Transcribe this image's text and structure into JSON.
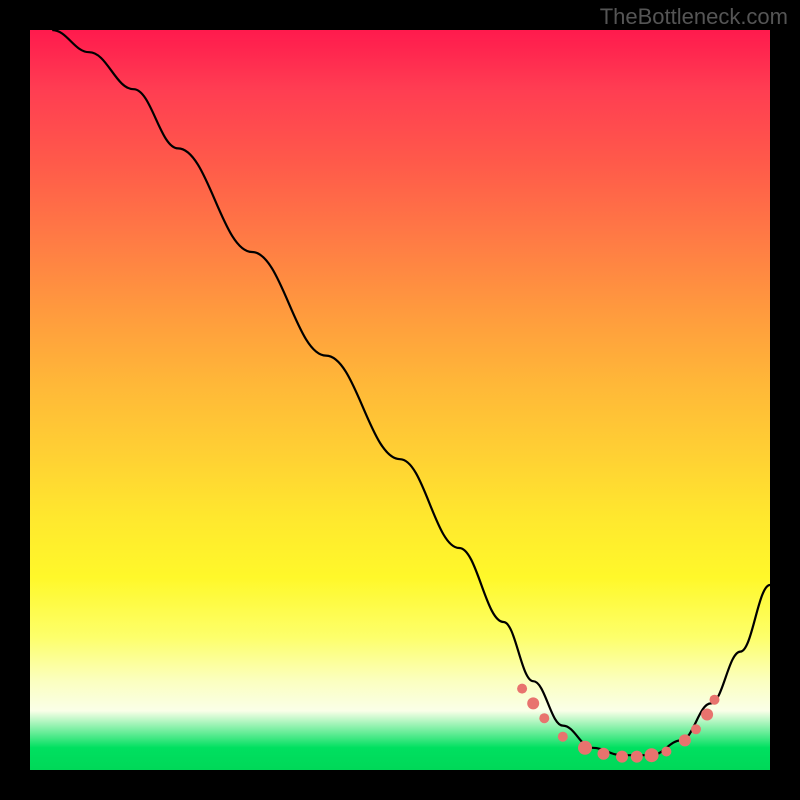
{
  "watermark": "TheBottleneck.com",
  "chart_data": {
    "type": "line",
    "title": "",
    "xlabel": "",
    "ylabel": "",
    "xlim": [
      0,
      1
    ],
    "ylim": [
      0,
      1
    ],
    "series": [
      {
        "name": "curve",
        "points": [
          [
            0.03,
            1.0
          ],
          [
            0.08,
            0.97
          ],
          [
            0.14,
            0.92
          ],
          [
            0.2,
            0.84
          ],
          [
            0.3,
            0.7
          ],
          [
            0.4,
            0.56
          ],
          [
            0.5,
            0.42
          ],
          [
            0.58,
            0.3
          ],
          [
            0.64,
            0.2
          ],
          [
            0.68,
            0.12
          ],
          [
            0.72,
            0.06
          ],
          [
            0.76,
            0.03
          ],
          [
            0.8,
            0.02
          ],
          [
            0.84,
            0.02
          ],
          [
            0.88,
            0.04
          ],
          [
            0.92,
            0.09
          ],
          [
            0.96,
            0.16
          ],
          [
            1.0,
            0.25
          ]
        ]
      }
    ],
    "markers": [
      {
        "x": 0.665,
        "y": 0.11,
        "r": 5
      },
      {
        "x": 0.68,
        "y": 0.09,
        "r": 6
      },
      {
        "x": 0.695,
        "y": 0.07,
        "r": 5
      },
      {
        "x": 0.72,
        "y": 0.045,
        "r": 5
      },
      {
        "x": 0.75,
        "y": 0.03,
        "r": 7
      },
      {
        "x": 0.775,
        "y": 0.022,
        "r": 6
      },
      {
        "x": 0.8,
        "y": 0.018,
        "r": 6
      },
      {
        "x": 0.82,
        "y": 0.018,
        "r": 6
      },
      {
        "x": 0.84,
        "y": 0.02,
        "r": 7
      },
      {
        "x": 0.86,
        "y": 0.025,
        "r": 5
      },
      {
        "x": 0.885,
        "y": 0.04,
        "r": 6
      },
      {
        "x": 0.9,
        "y": 0.055,
        "r": 5
      },
      {
        "x": 0.915,
        "y": 0.075,
        "r": 6
      },
      {
        "x": 0.925,
        "y": 0.095,
        "r": 5
      }
    ],
    "gradient_stops": [
      {
        "pos": 0.0,
        "color": "#ff1a4d"
      },
      {
        "pos": 0.5,
        "color": "#ffd233"
      },
      {
        "pos": 0.92,
        "color": "#faffe8"
      },
      {
        "pos": 1.0,
        "color": "#00d858"
      }
    ]
  }
}
